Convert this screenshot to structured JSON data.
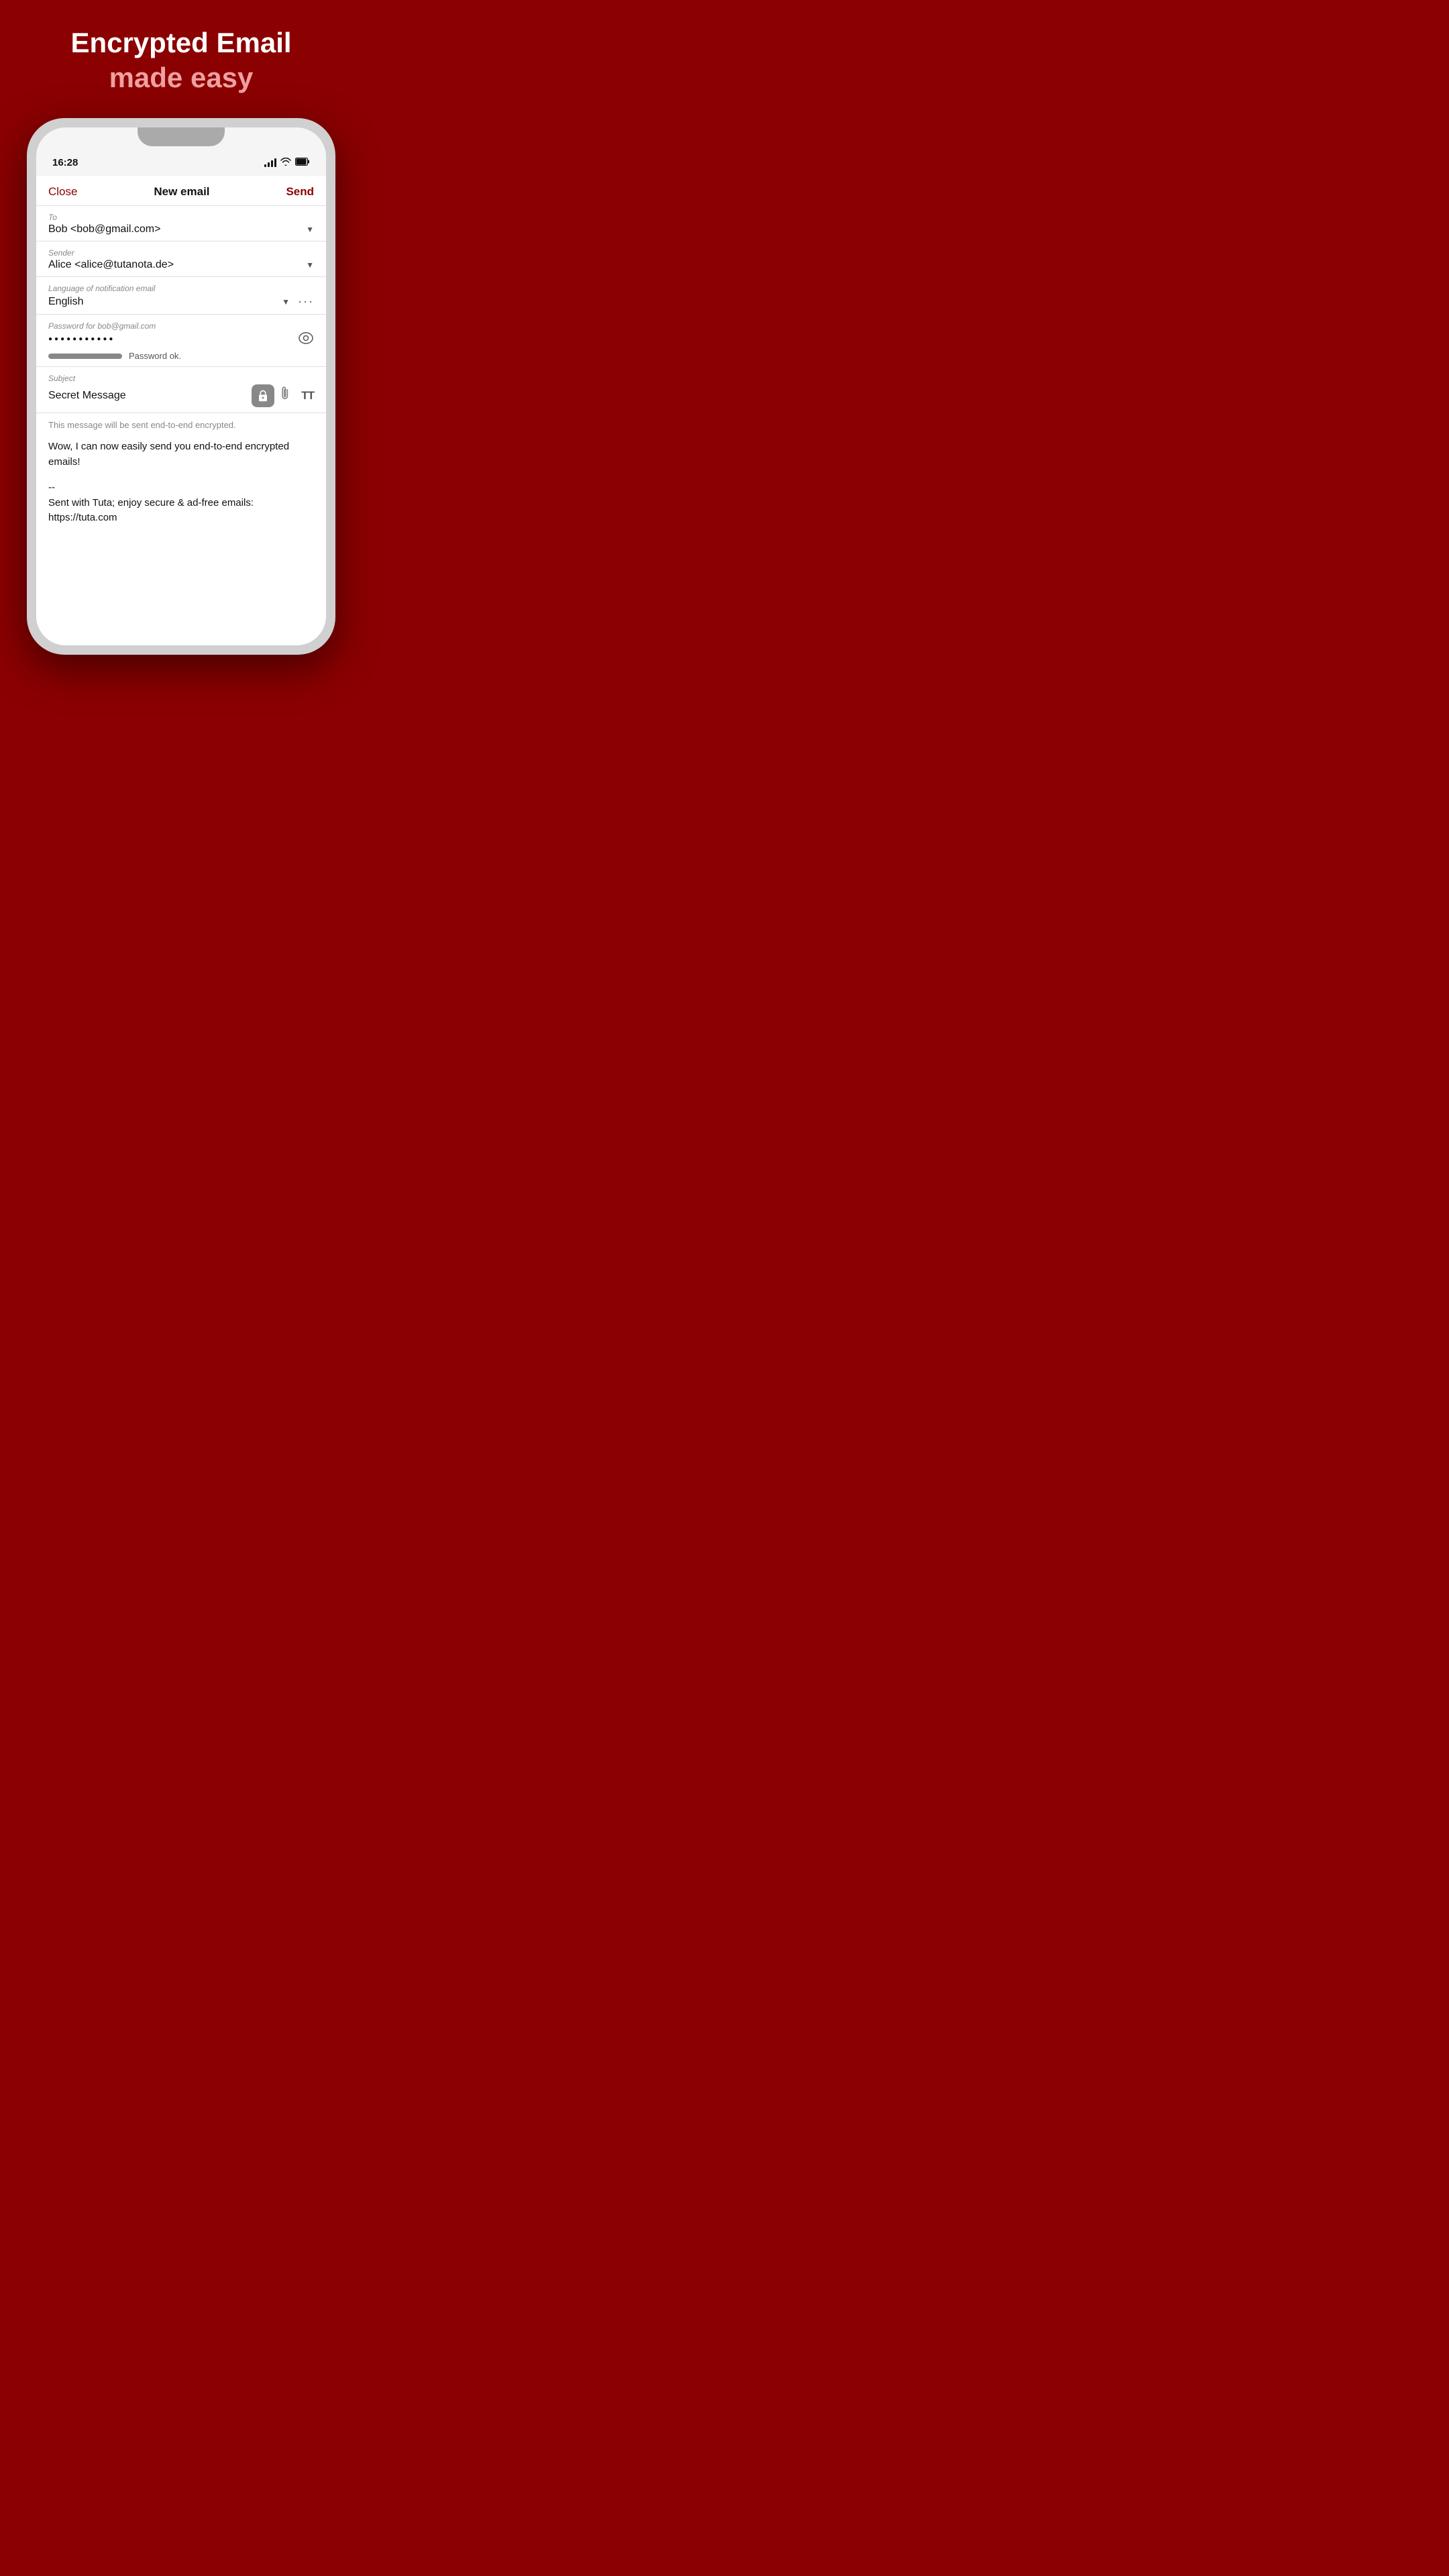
{
  "hero": {
    "title": "Encrypted Email",
    "subtitle": "made easy"
  },
  "phone": {
    "status_bar": {
      "time": "16:28"
    },
    "email_screen": {
      "topbar": {
        "close_label": "Close",
        "title_label": "New email",
        "send_label": "Send"
      },
      "to_field": {
        "label": "To",
        "value": "Bob <bob@gmail.com>"
      },
      "sender_field": {
        "label": "Sender",
        "value": "Alice <alice@tutanota.de>"
      },
      "language_field": {
        "label": "Language of notification email",
        "value": "English"
      },
      "password_field": {
        "label": "Password for bob@gmail.com",
        "dots": "●●●●●●●●●●●",
        "ok_text": "Password ok."
      },
      "subject_field": {
        "label": "Subject",
        "value": "Secret Message"
      },
      "encrypt_notice": "This message will be sent end-to-end encrypted.",
      "message": "Wow, I can now easily send you end-to-end encrypted emails!",
      "signature_line1": "--",
      "signature_line2": "Sent with Tuta; enjoy secure & ad-free emails:",
      "signature_line3": "https://tuta.com"
    }
  }
}
